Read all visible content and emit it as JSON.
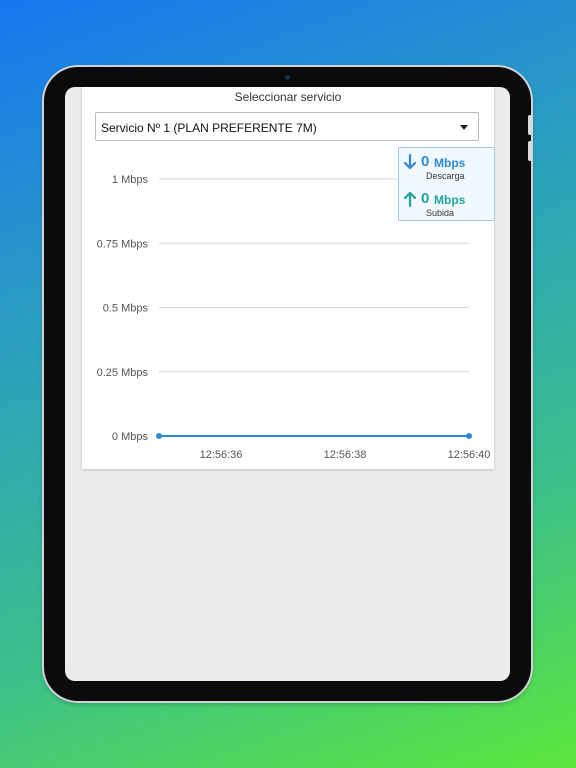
{
  "service_selector": {
    "label": "Seleccionar servicio",
    "selected": "Servicio Nº 1 (PLAN PREFERENTE 7M)"
  },
  "speed_box": {
    "download": {
      "value": "0",
      "unit": "Mbps",
      "label": "Descarga",
      "color": "#2e88d6",
      "icon": "arrow-down-icon"
    },
    "upload": {
      "value": "0",
      "unit": "Mbps",
      "label": "Subida",
      "color": "#20a59a",
      "icon": "arrow-up-icon"
    }
  },
  "chart_data": {
    "type": "line",
    "x": [
      "12:56:36",
      "12:56:38",
      "12:56:40"
    ],
    "y_ticks": [
      "1 Mbps",
      "0.75 Mbps",
      "0.5 Mbps",
      "0.25 Mbps",
      "0 Mbps"
    ],
    "ylim": [
      0,
      1
    ],
    "grid": true,
    "series": [
      {
        "color": "#2e88d6",
        "points": [
          {
            "x": "12:56:35",
            "y": 0
          },
          {
            "x": "12:56:40",
            "y": 0
          }
        ]
      }
    ]
  }
}
